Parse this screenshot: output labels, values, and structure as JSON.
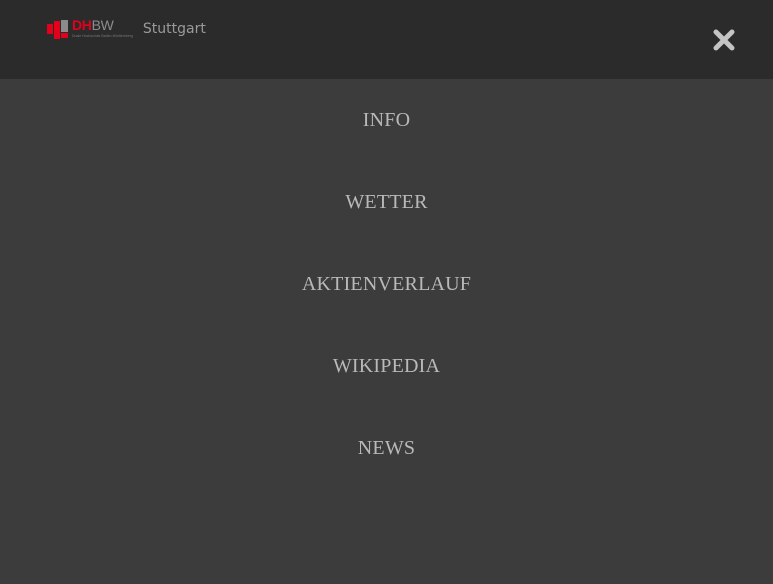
{
  "header": {
    "logo": {
      "abbr_red": "DH",
      "abbr_grey": "BW",
      "tagline": "Duale Hochschule Baden-Württemberg",
      "city": "Stuttgart"
    },
    "close_icon": "close-icon"
  },
  "menu": {
    "items": [
      {
        "label": "INFO"
      },
      {
        "label": "WETTER"
      },
      {
        "label": "AKTIENVERLAUF"
      },
      {
        "label": "WIKIPEDIA"
      },
      {
        "label": "NEWS"
      }
    ]
  },
  "colors": {
    "header_bg": "#2b2b2b",
    "page_bg": "#3c3c3c",
    "menu_text": "#b9b9b9",
    "brand_red": "#e2001a"
  }
}
